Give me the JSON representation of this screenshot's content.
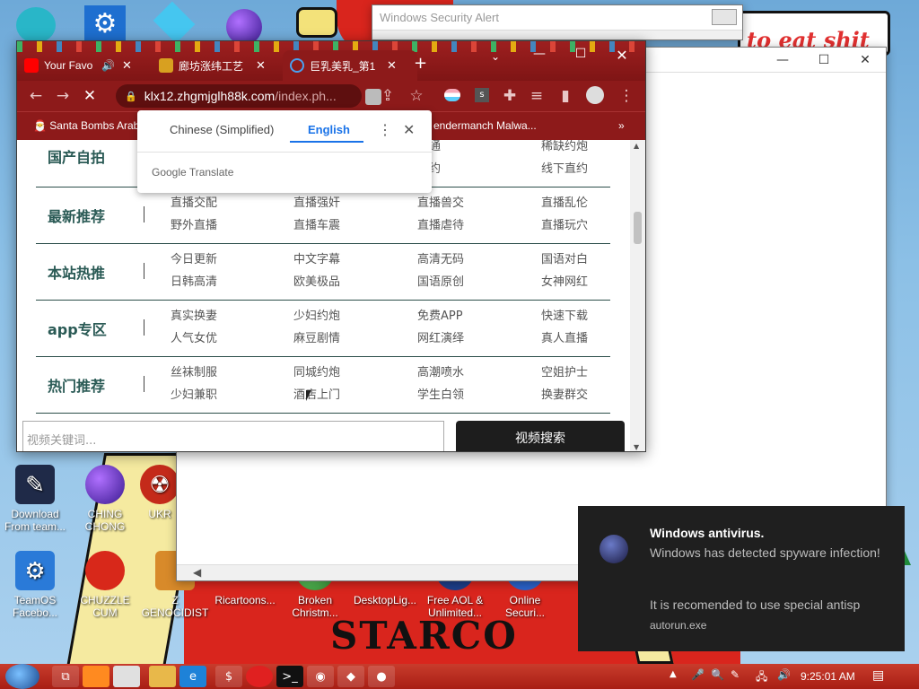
{
  "desktop": {
    "wallpaper_text": "STARCO",
    "wallpaper_scrawl": "to eat shit",
    "icons": [
      {
        "label": "Download From team...",
        "icon": "document-icon"
      },
      {
        "label": "CHING CHONG",
        "icon": "ornament-icon"
      },
      {
        "label": "UKR",
        "icon": "radiation-icon"
      },
      {
        "label": "TeamOS Facebo...",
        "icon": "gear-icon"
      },
      {
        "label": "CHUZZLE CUM",
        "icon": "chuzzle-icon"
      },
      {
        "label": "Z GENOCIDIST",
        "icon": "box-icon"
      },
      {
        "label": "Ricartoons...",
        "icon": "cartoon-icon"
      },
      {
        "label": "Broken Christm...",
        "icon": "ornament-icon"
      },
      {
        "label": "DesktopLig...",
        "icon": "lights-icon"
      },
      {
        "label": "Free AOL & Unlimited...",
        "icon": "aol-icon"
      },
      {
        "label": "Online Securi...",
        "icon": "shield-icon"
      }
    ]
  },
  "security_alert": {
    "title": "Windows Security Alert"
  },
  "browser": {
    "tabs": [
      {
        "label": "Your Favo",
        "icon": "youtube-icon",
        "active": false
      },
      {
        "label": "廊坊涨纬工艺",
        "icon": "site-icon",
        "active": false
      },
      {
        "label": "巨乳美乳_第1",
        "icon": "loading-icon",
        "active": true
      }
    ],
    "url_domain": "klx12.zhgmjglh88k.com",
    "url_path": "/index.ph...",
    "bookmarks": [
      "Santa Bombs Arab",
      "endermanch Malwa..."
    ],
    "translate": {
      "lang_source": "Chinese (Simplified)",
      "lang_target": "English",
      "brand_google": "Google",
      "brand_translate": "Translate"
    },
    "rows": [
      {
        "head": "国产自拍",
        "cells": [
          "",
          "",
          "课通",
          "稀缺约炮",
          "",
          "",
          "预约",
          "线下直约"
        ]
      },
      {
        "head": "最新推荐",
        "cells": [
          "直播交配",
          "直播强奸",
          "直播兽交",
          "直播乱伦",
          "野外直播",
          "直播车震",
          "直播虐待",
          "直播玩穴"
        ]
      },
      {
        "head": "本站热推",
        "cells": [
          "今日更新",
          "中文字幕",
          "高清无码",
          "国语对白",
          "日韩高清",
          "欧美极品",
          "国语原创",
          "女神网红"
        ]
      },
      {
        "head": "app专区",
        "cells": [
          "真实换妻",
          "少妇约炮",
          "免费APP",
          "快速下载",
          "人气女优",
          "麻豆剧情",
          "网红演绎",
          "真人直播"
        ]
      },
      {
        "head": "热门推荐",
        "cells": [
          "丝袜制服",
          "同城约炮",
          "高潮喷水",
          "空姐护士",
          "少妇兼职",
          "酒店上门",
          "学生白领",
          "换妻群交"
        ]
      }
    ],
    "search_placeholder": "视频关键词...",
    "search_button": "视频搜索"
  },
  "notification": {
    "title": "Windows antivirus.",
    "body": "Windows has detected spyware infection!",
    "detail": "It is recomended to use special antisp",
    "source": "autorun.exe"
  },
  "taskbar": {
    "clock": "9:25:01 AM"
  }
}
